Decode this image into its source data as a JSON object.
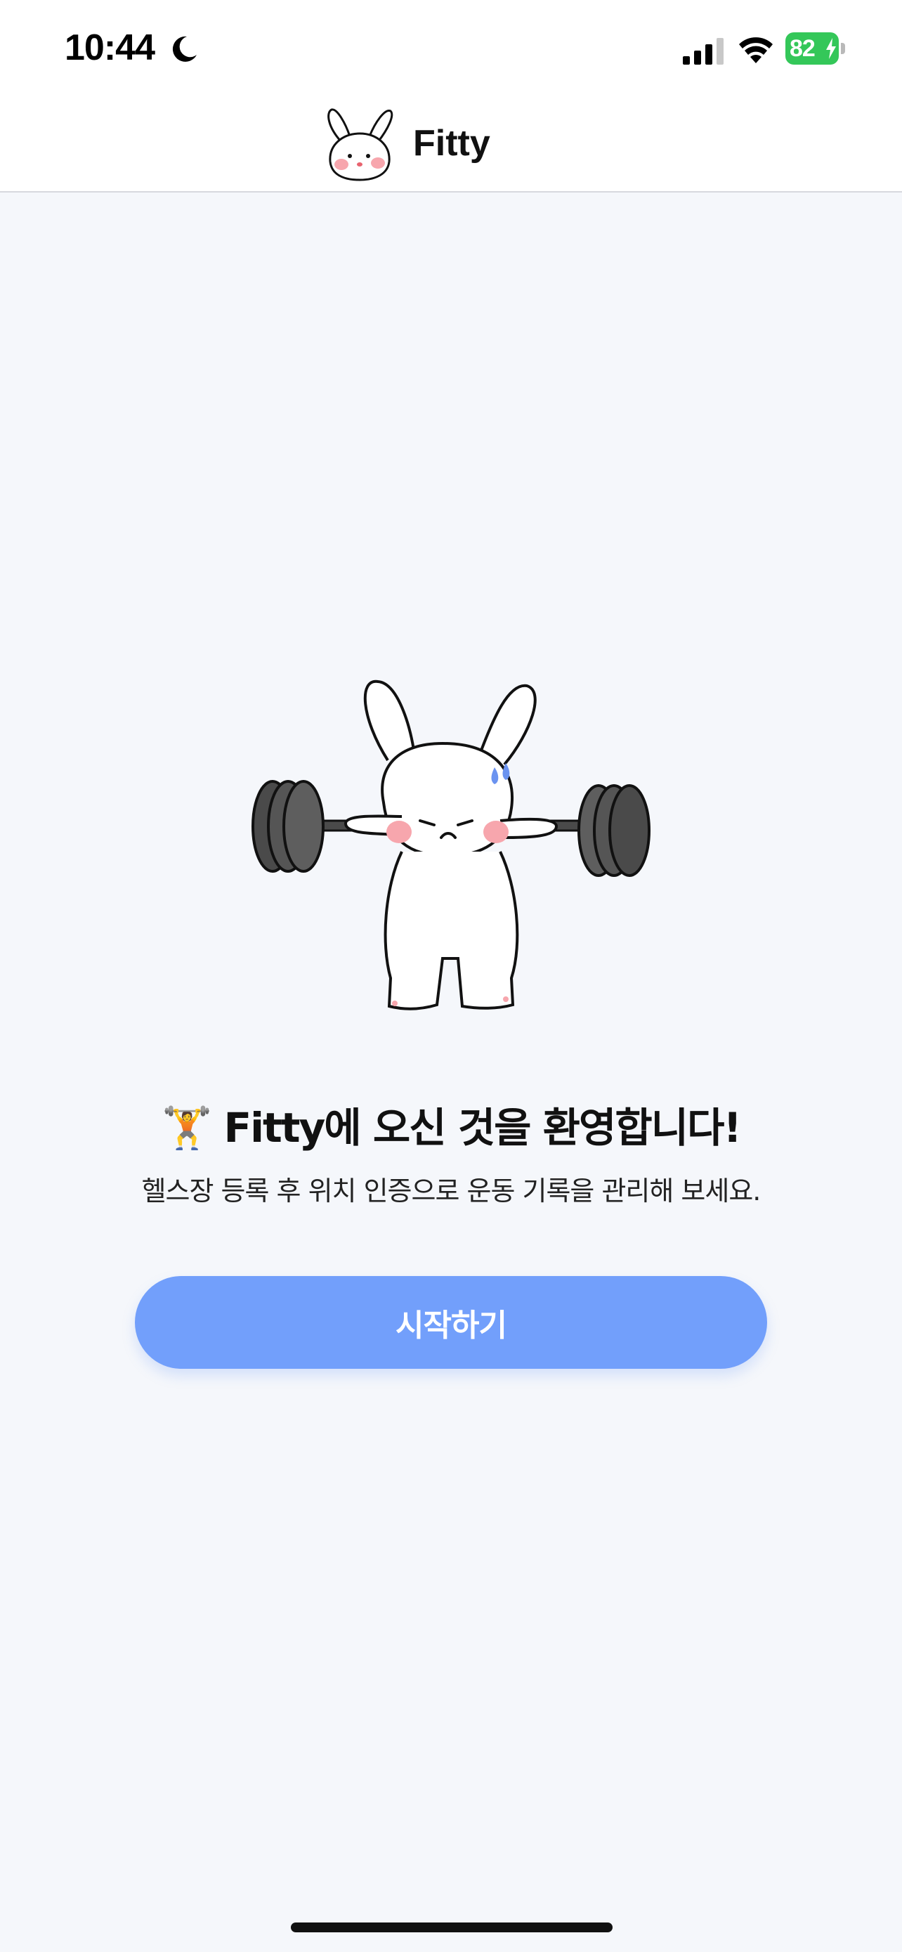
{
  "status_bar": {
    "time": "10:44",
    "battery": "82",
    "icons": [
      "moon-icon",
      "signal-icon",
      "wifi-icon",
      "battery-charging-icon"
    ],
    "battery_color": "#34c759"
  },
  "header": {
    "title": "Fitty",
    "logo_icon": "bunny-face-logo"
  },
  "main": {
    "illustration": "bunny-lifting-barbell",
    "title": "🏋️ Fitty에 오신 것을 환영합니다!",
    "subtitle": "헬스장 등록 후 위치 인증으로 운동 기록을 관리해 보세요.",
    "start_button_label": "시작하기"
  },
  "colors": {
    "accent": "#729ffb",
    "background": "#f5f7fb",
    "header_background": "#ffffff"
  }
}
